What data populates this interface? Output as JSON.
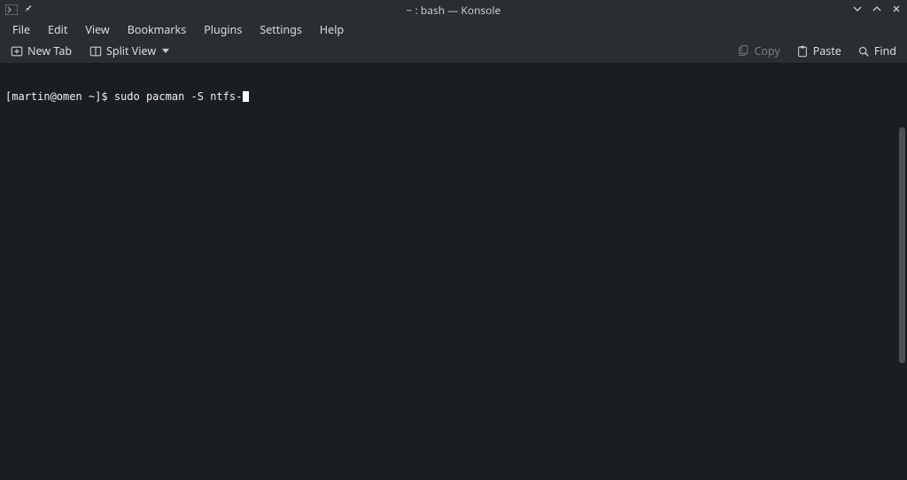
{
  "titlebar": {
    "title": "~ : bash — Konsole"
  },
  "menu": {
    "items": [
      {
        "label": "File"
      },
      {
        "label": "Edit"
      },
      {
        "label": "View"
      },
      {
        "label": "Bookmarks"
      },
      {
        "label": "Plugins"
      },
      {
        "label": "Settings"
      },
      {
        "label": "Help"
      }
    ]
  },
  "toolbar": {
    "new_tab": "New Tab",
    "split_view": "Split View",
    "copy": "Copy",
    "paste": "Paste",
    "find": "Find"
  },
  "terminal": {
    "prompt": "[martin@omen ~]$ ",
    "command": "sudo pacman -S ntfs-"
  }
}
